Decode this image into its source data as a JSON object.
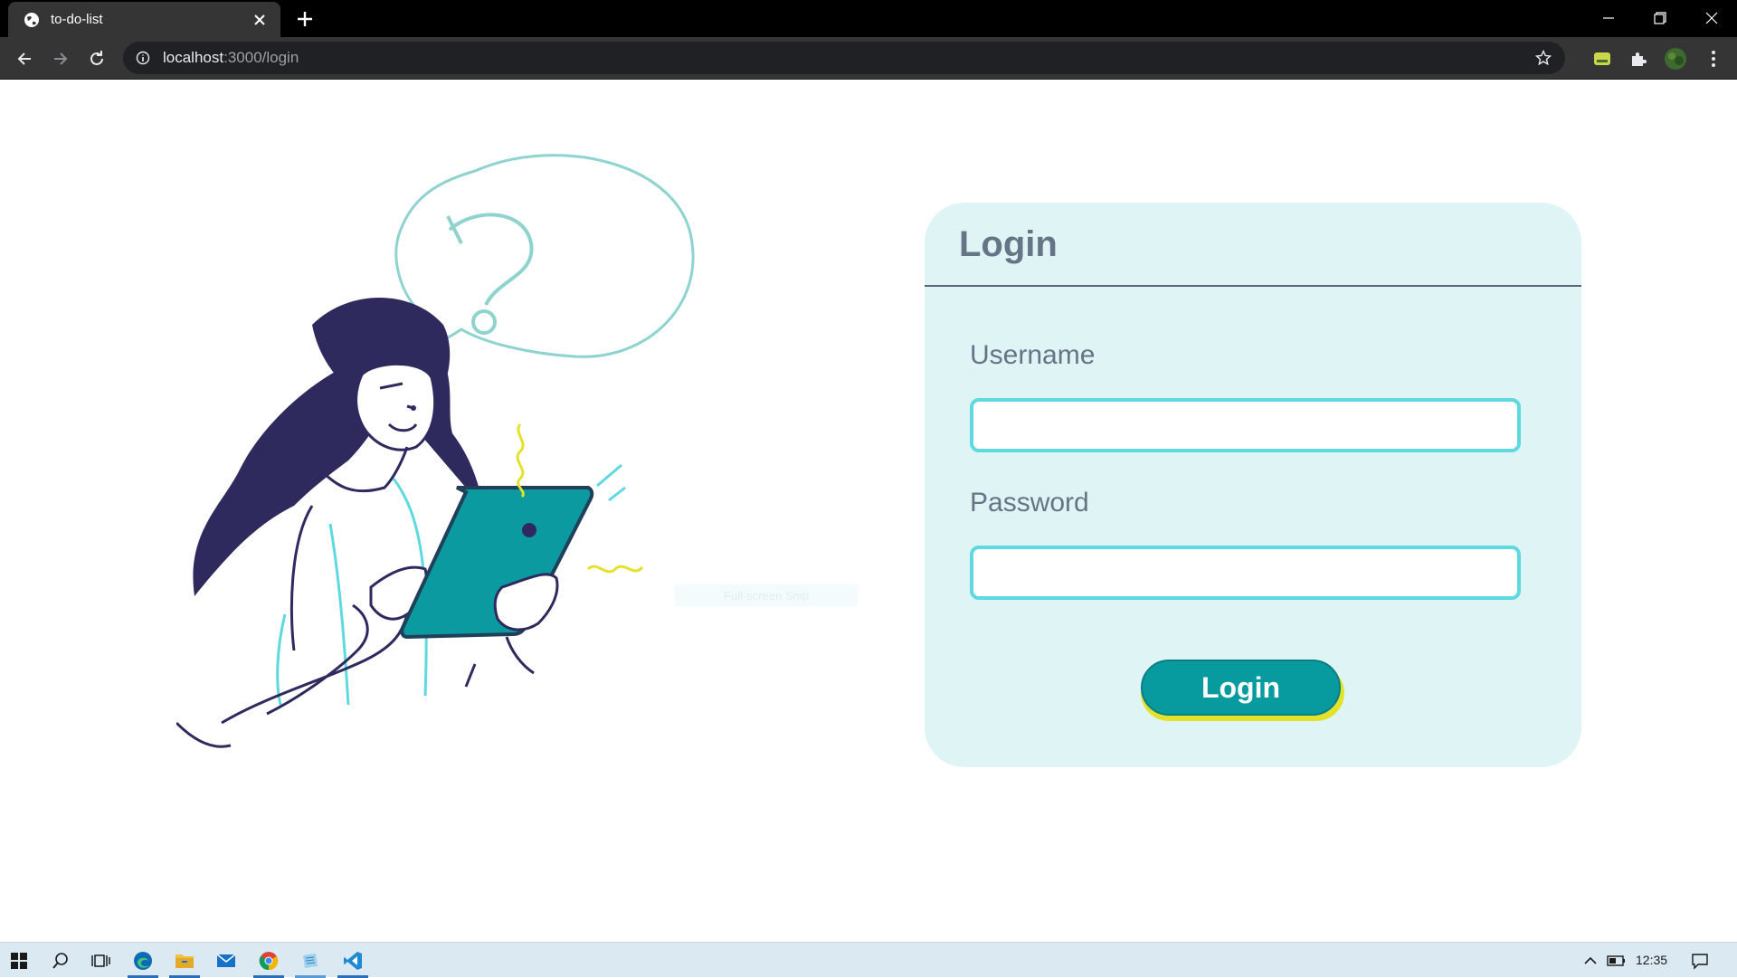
{
  "browser": {
    "tab_title": "to-do-list",
    "url_host": "localhost",
    "url_path": ":3000/login"
  },
  "illustration": {
    "overlay_text": "Full-screen Snip"
  },
  "login": {
    "title": "Login",
    "username_label": "Username",
    "username_value": "",
    "password_label": "Password",
    "password_value": "",
    "submit_label": "Login"
  },
  "colors": {
    "card_bg": "#dff4f5",
    "input_border": "#5fd9e0",
    "button_bg": "#079ba0",
    "button_shadow": "#e3e22a",
    "text_muted": "#667485"
  },
  "taskbar": {
    "clock": "12:35",
    "apps": [
      "start-icon",
      "search-icon",
      "task-view-icon",
      "edge-icon",
      "file-explorer-icon",
      "mail-icon",
      "chrome-icon",
      "notepad-icon",
      "vscode-icon"
    ]
  }
}
